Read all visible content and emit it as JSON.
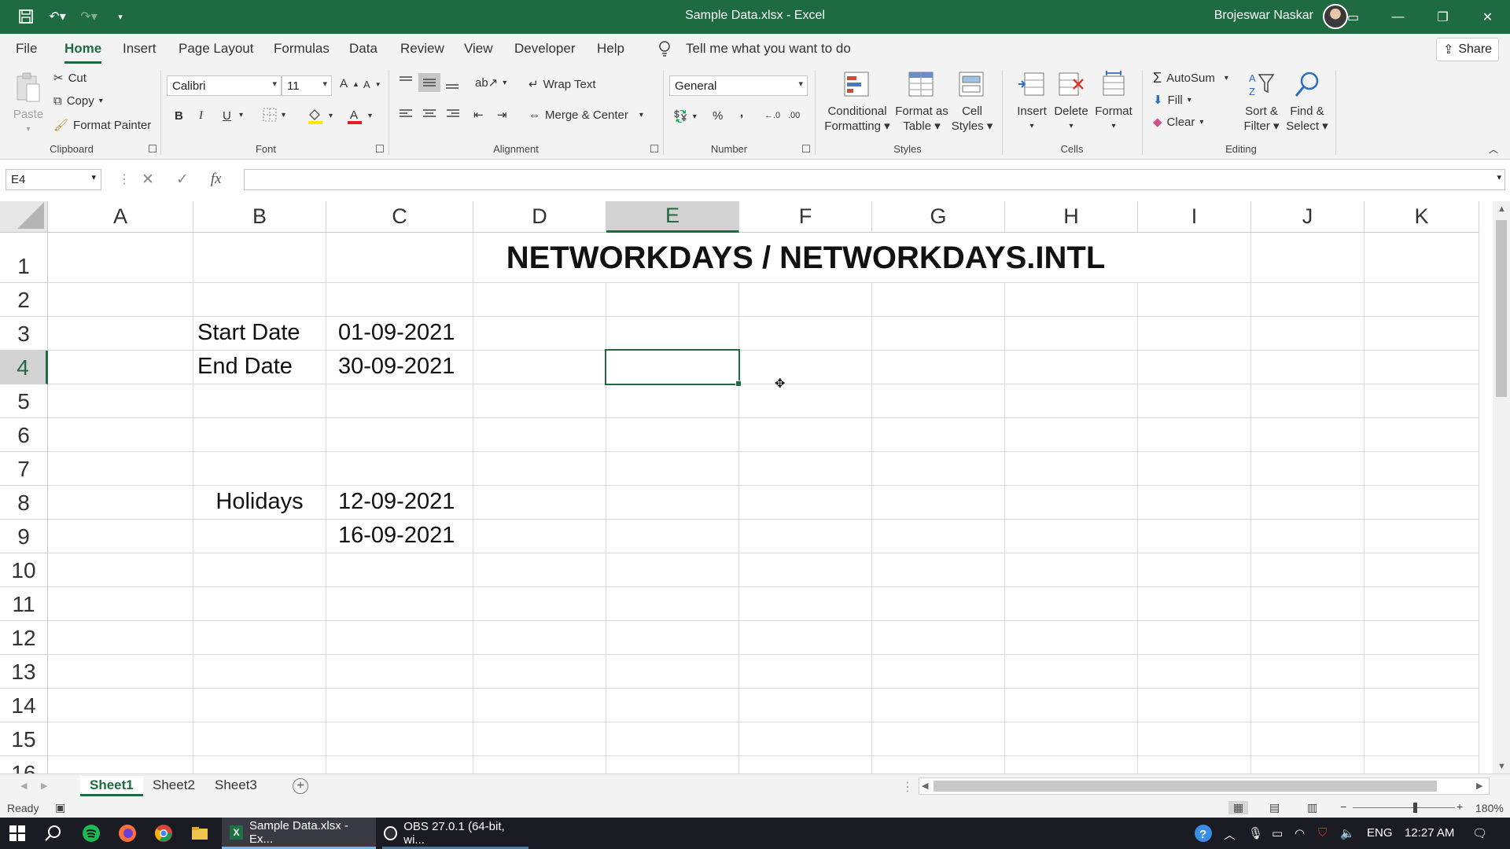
{
  "window": {
    "title": "Sample Data.xlsx  -  Excel",
    "user": "Brojeswar Naskar"
  },
  "menu": {
    "tabs": [
      "File",
      "Home",
      "Insert",
      "Page Layout",
      "Formulas",
      "Data",
      "Review",
      "View",
      "Developer",
      "Help"
    ],
    "active": "Home",
    "tell_me": "Tell me what you want to do",
    "share": "Share"
  },
  "ribbon": {
    "clipboard": {
      "label": "Clipboard",
      "paste": "Paste",
      "cut": "Cut",
      "copy": "Copy",
      "format_painter": "Format Painter"
    },
    "font": {
      "label": "Font",
      "name": "Calibri",
      "size": "11",
      "bold": "B",
      "italic": "I",
      "underline": "U",
      "grow": "A",
      "shrink": "A"
    },
    "alignment": {
      "label": "Alignment",
      "wrap_text": "Wrap Text",
      "merge_center": "Merge & Center"
    },
    "number": {
      "label": "Number",
      "format": "General",
      "percent": "%",
      "comma": ",",
      "inc_decimal": "←.0",
      "dec_decimal": ".00"
    },
    "styles": {
      "label": "Styles",
      "conditional": "Conditional",
      "conditional2": "Formatting",
      "format_table": "Format as",
      "format_table2": "Table",
      "cell_styles": "Cell",
      "cell_styles2": "Styles"
    },
    "cells": {
      "label": "Cells",
      "insert": "Insert",
      "delete": "Delete",
      "format": "Format"
    },
    "editing": {
      "label": "Editing",
      "autosum": "AutoSum",
      "fill": "Fill",
      "clear": "Clear",
      "sort": "Sort &",
      "sort2": "Filter",
      "find": "Find &",
      "find2": "Select"
    }
  },
  "formula_bar": {
    "name_box": "E4",
    "fx": "fx",
    "value": ""
  },
  "grid": {
    "columns": [
      "A",
      "B",
      "C",
      "D",
      "E",
      "F",
      "G",
      "H",
      "I",
      "J",
      "K"
    ],
    "rows": [
      "1",
      "2",
      "3",
      "4",
      "5",
      "6",
      "7",
      "8",
      "9",
      "10",
      "11",
      "12",
      "13",
      "14",
      "15",
      "16"
    ],
    "selected_column": "E",
    "selected_row": "4",
    "cells": {
      "title": "NETWORKDAYS / NETWORKDAYS.INTL",
      "b3": "Start Date",
      "c3": "01-09-2021",
      "b4": "End Date",
      "c4": "30-09-2021",
      "b8": "Holidays",
      "c8": "12-09-2021",
      "c9": "16-09-2021"
    }
  },
  "sheets": {
    "tabs": [
      "Sheet1",
      "Sheet2",
      "Sheet3"
    ],
    "active": "Sheet1"
  },
  "status": {
    "ready": "Ready",
    "zoom": "180%"
  },
  "taskbar": {
    "apps": [
      {
        "label": "Sample Data.xlsx - Ex...",
        "active": true
      },
      {
        "label": "OBS 27.0.1 (64-bit, wi...",
        "active": false
      }
    ],
    "lang": "ENG",
    "time": "12:27 AM"
  },
  "colors": {
    "excel_green": "#1e6b41",
    "taskbar": "#1b1b24"
  }
}
